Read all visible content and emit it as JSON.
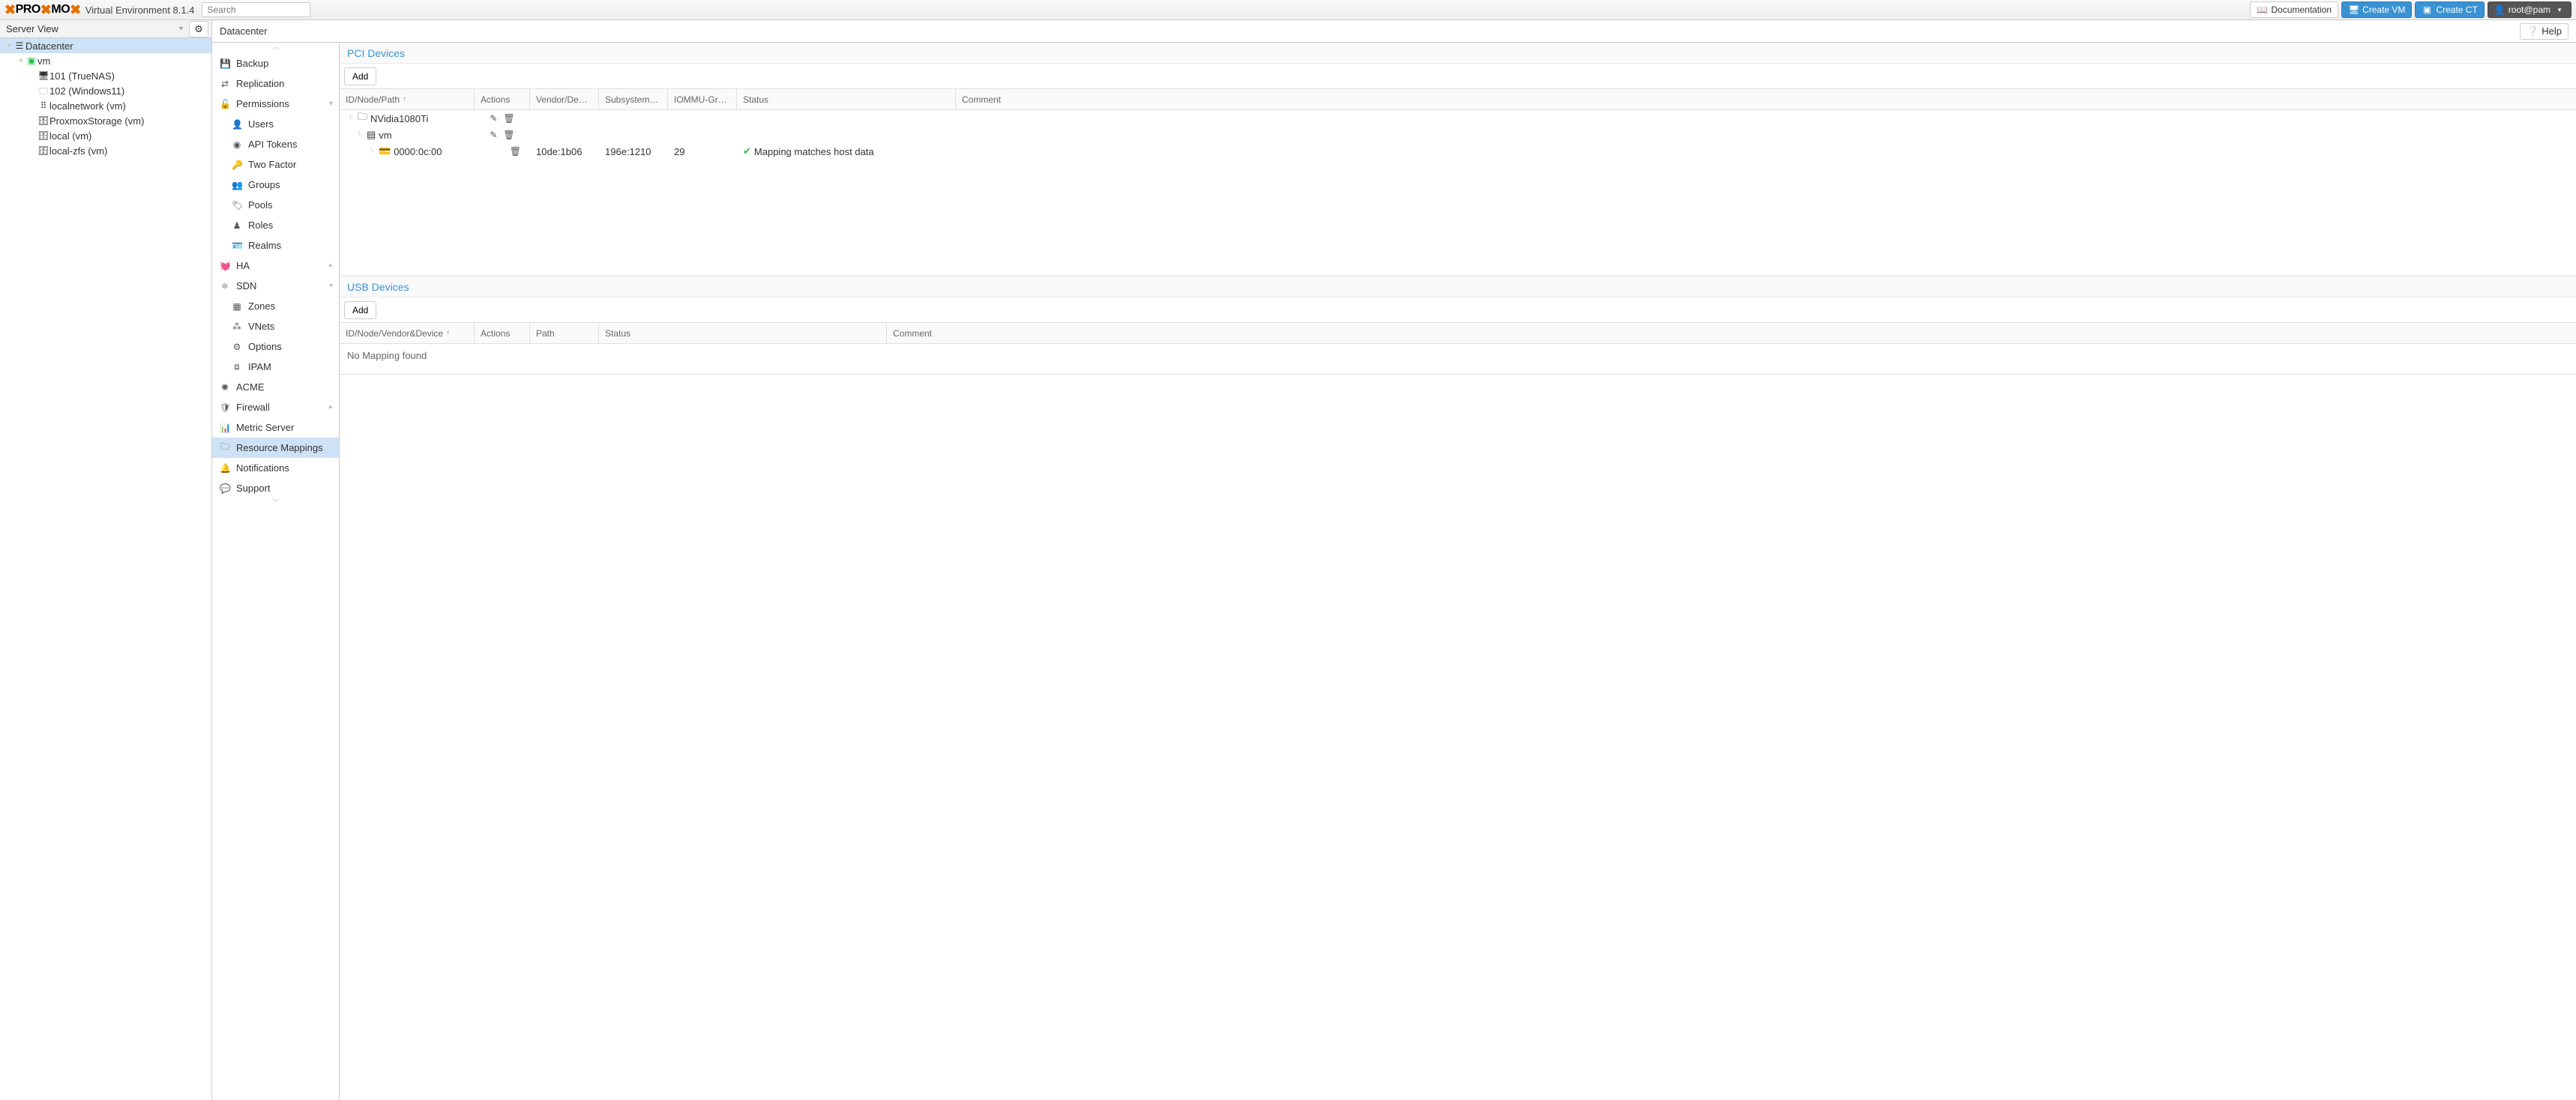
{
  "header": {
    "brand1": "PRO",
    "brand2": "MO",
    "subtitle": "Virtual Environment 8.1.4",
    "search_placeholder": "Search",
    "doc": "Documentation",
    "create_vm": "Create VM",
    "create_ct": "Create CT",
    "user": "root@pam"
  },
  "left": {
    "view": "Server View",
    "nodes": {
      "datacenter": "Datacenter",
      "vm": "vm",
      "n101": "101 (TrueNAS)",
      "n102": "102 (Windows11)",
      "localnetwork": "localnetwork (vm)",
      "proxstorage": "ProxmoxStorage (vm)",
      "local": "local (vm)",
      "localzfs": "local-zfs (vm)"
    }
  },
  "content_title": "Datacenter",
  "help": "Help",
  "menu": {
    "backup": "Backup",
    "replication": "Replication",
    "permissions": "Permissions",
    "users": "Users",
    "apitokens": "API Tokens",
    "twofactor": "Two Factor",
    "groups": "Groups",
    "pools": "Pools",
    "roles": "Roles",
    "realms": "Realms",
    "ha": "HA",
    "sdn": "SDN",
    "zones": "Zones",
    "vnets": "VNets",
    "options": "Options",
    "ipam": "IPAM",
    "acme": "ACME",
    "firewall": "Firewall",
    "metric": "Metric Server",
    "resmap": "Resource Mappings",
    "notifications": "Notifications",
    "support": "Support"
  },
  "pci": {
    "title": "PCI Devices",
    "add": "Add",
    "cols": {
      "id": "ID/Node/Path",
      "actions": "Actions",
      "vendor": "Vendor/De…",
      "subsystem": "Subsystem…",
      "iommu": "IOMMU-Gr…",
      "status": "Status",
      "comment": "Comment"
    },
    "rows": {
      "r1": "NVidia1080Ti",
      "r2": "vm",
      "r3": "0000:0c:00",
      "vendor": "10de:1b06",
      "subsystem": "196e:1210",
      "iommu": "29",
      "status": "Mapping matches host data"
    }
  },
  "usb": {
    "title": "USB Devices",
    "add": "Add",
    "cols": {
      "id": "ID/Node/Vendor&Device",
      "actions": "Actions",
      "path": "Path",
      "status": "Status",
      "comment": "Comment"
    },
    "empty": "No Mapping found"
  }
}
